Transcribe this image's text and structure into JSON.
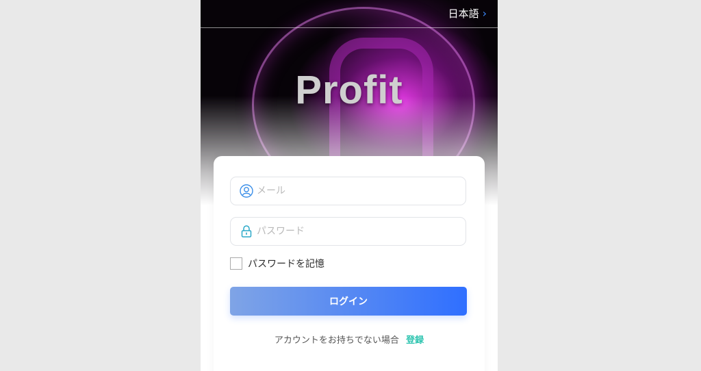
{
  "header": {
    "language_label": "日本語",
    "chevron_glyph": "›",
    "brand_text": "Profit"
  },
  "form": {
    "email": {
      "placeholder": "メール",
      "value": ""
    },
    "password": {
      "placeholder": "パスワード",
      "value": ""
    },
    "remember_label": "パスワードを記憶",
    "remember_checked": false,
    "login_label": "ログイン"
  },
  "signup": {
    "prompt": "アカウントをお持ちでない場合",
    "link_label": "登録"
  },
  "colors": {
    "accent": "#2f6fff",
    "link": "#2ec4b0",
    "page_bg": "#e9e9e9"
  },
  "icons": [
    "user-icon",
    "lock-icon",
    "chevron-right-icon"
  ]
}
